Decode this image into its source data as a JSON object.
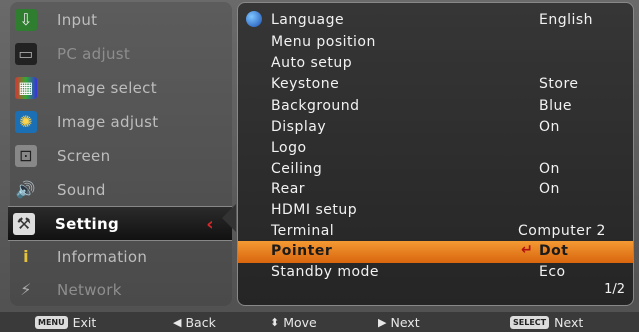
{
  "sidebar": {
    "items": [
      {
        "label": "Input",
        "icon": "input-icon",
        "dim": false
      },
      {
        "label": "PC adjust",
        "icon": "pc-adjust-icon",
        "dim": true
      },
      {
        "label": "Image select",
        "icon": "image-select-icon",
        "dim": false
      },
      {
        "label": "Image adjust",
        "icon": "image-adjust-icon",
        "dim": false
      },
      {
        "label": "Screen",
        "icon": "screen-icon",
        "dim": false
      },
      {
        "label": "Sound",
        "icon": "sound-icon",
        "dim": false
      },
      {
        "label": "Setting",
        "icon": "setting-icon",
        "dim": false,
        "selected": true
      },
      {
        "label": "Information",
        "icon": "information-icon",
        "dim": false
      },
      {
        "label": "Network",
        "icon": "network-icon",
        "dim": true
      }
    ],
    "selected_marker": "‹"
  },
  "settings": {
    "rows": [
      {
        "label": "Language",
        "value": "English"
      },
      {
        "label": "Menu position",
        "value": ""
      },
      {
        "label": "Auto setup",
        "value": ""
      },
      {
        "label": "Keystone",
        "value": "Store"
      },
      {
        "label": "Background",
        "value": "Blue"
      },
      {
        "label": "Display",
        "value": "On"
      },
      {
        "label": "Logo",
        "value": ""
      },
      {
        "label": "Ceiling",
        "value": "On"
      },
      {
        "label": "Rear",
        "value": "On"
      },
      {
        "label": "HDMI setup",
        "value": ""
      },
      {
        "label": "Terminal",
        "value": "Computer 2"
      },
      {
        "label": "Pointer",
        "value": "Dot",
        "highlighted": true
      },
      {
        "label": "Standby mode",
        "value": "Eco"
      }
    ],
    "highlight_mark": "↵",
    "page": "1/2"
  },
  "footer": {
    "exit_key": "MENU",
    "exit_label": "Exit",
    "back_label": "Back",
    "move_label": "Move",
    "next_label": "Next",
    "select_key": "SELECT",
    "select_next_label": "Next"
  },
  "colors": {
    "highlight": "#ef8a24",
    "selected_marker": "#d8282a"
  }
}
